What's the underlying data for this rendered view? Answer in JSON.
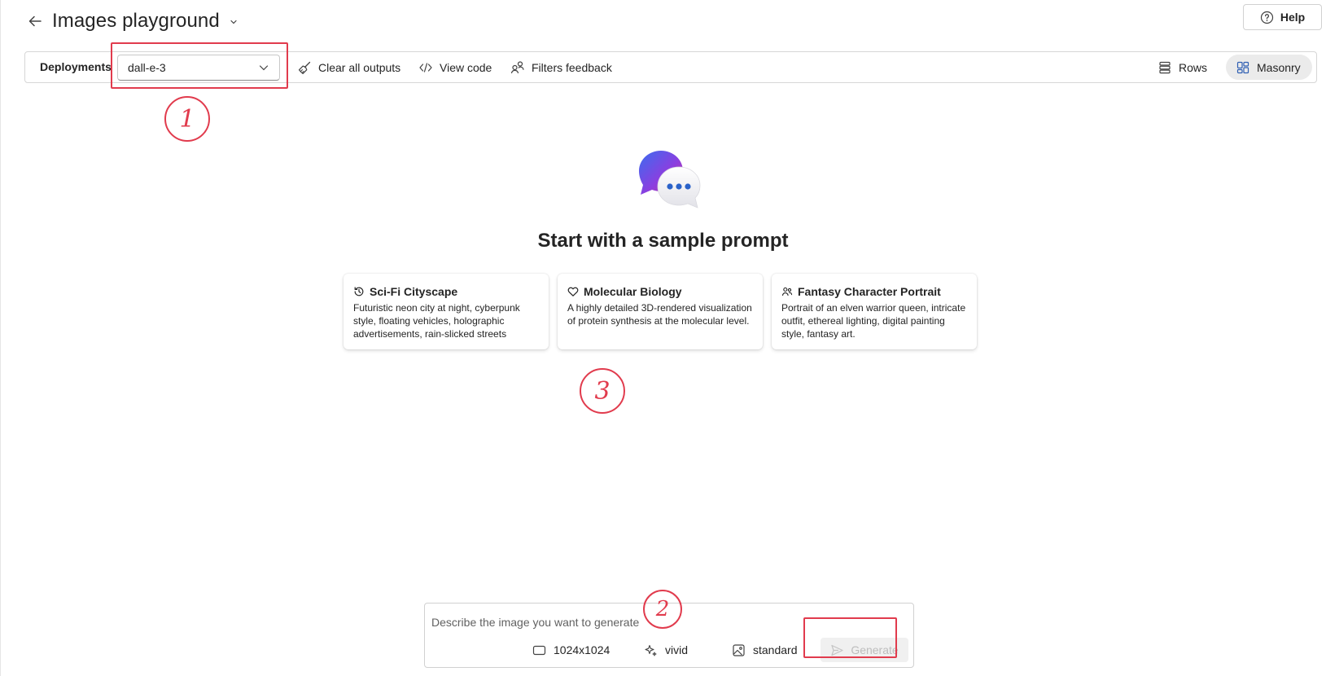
{
  "header": {
    "title": "Images playground",
    "back_icon": "arrow-left-icon",
    "help_label": "Help"
  },
  "toolbar": {
    "deployments_label": "Deployments",
    "deployment_value": "dall-e-3",
    "clear_label": "Clear all outputs",
    "view_code_label": "View code",
    "filters_label": "Filters feedback",
    "rows_label": "Rows",
    "masonry_label": "Masonry",
    "active_view": "Masonry"
  },
  "empty_state": {
    "title": "Start with a sample prompt"
  },
  "sample_prompts": [
    {
      "title": "Sci-Fi Cityscape",
      "icon": "history-icon",
      "description": "Futuristic neon city at night, cyberpunk style, floating vehicles, holographic advertisements, rain-slicked streets"
    },
    {
      "title": "Molecular Biology",
      "icon": "heart-icon",
      "description": "A highly detailed 3D-rendered visualization of protein synthesis at the molecular level."
    },
    {
      "title": "Fantasy Character Portrait",
      "icon": "people-icon",
      "description": "Portrait of an elven warrior queen, intricate outfit, ethereal lighting, digital painting style, fantasy art."
    }
  ],
  "prompt": {
    "placeholder": "Describe the image you want to generate",
    "size": "1024x1024",
    "style": "vivid",
    "quality": "standard",
    "generate_label": "Generate"
  },
  "annotations": [
    "1",
    "2",
    "3"
  ],
  "colors": {
    "annotation": "#e13b4d",
    "masonry_active_bg": "#ebebeb"
  }
}
